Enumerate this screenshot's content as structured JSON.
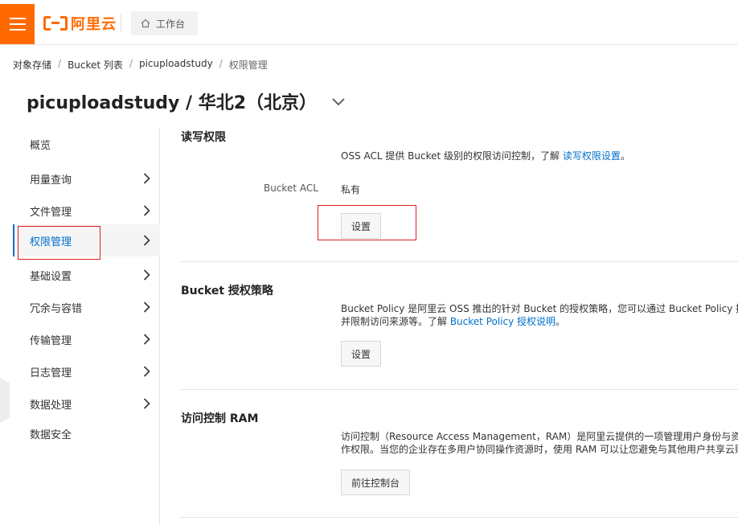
{
  "header": {
    "logo_text": "阿里云",
    "workbench_label": "工作台"
  },
  "breadcrumb": [
    "对象存储",
    "Bucket 列表",
    "picuploadstudy",
    "权限管理"
  ],
  "page_title": "picuploadstudy / 华北2（北京）",
  "sidebar": {
    "items": [
      {
        "label": "概览"
      },
      {
        "label": "用量查询"
      },
      {
        "label": "文件管理"
      },
      {
        "label": "权限管理"
      },
      {
        "label": "基础设置"
      },
      {
        "label": "冗余与容错"
      },
      {
        "label": "传输管理"
      },
      {
        "label": "日志管理"
      },
      {
        "label": "数据处理"
      },
      {
        "label": "数据安全"
      }
    ],
    "active": "权限管理"
  },
  "sections": {
    "acl": {
      "title": "读写权限",
      "desc_prefix": "OSS ACL 提供 Bucket 级别的权限访问控制，了解 ",
      "desc_link": "读写权限设置",
      "desc_suffix": "。",
      "field_label": "Bucket ACL",
      "field_value": "私有",
      "button": "设置"
    },
    "policy": {
      "title": "Bucket 授权策略",
      "desc_line1": "Bucket Policy 是阿里云 OSS 推出的针对 Bucket 的授权策略，您可以通过 Bucket Policy 授权",
      "desc_line2_prefix": "并限制访问来源等。了解 ",
      "desc_link": "Bucket Policy 授权说明",
      "desc_suffix": "。",
      "button": "设置"
    },
    "ram": {
      "title": "访问控制 RAM",
      "desc_line1": "访问控制（Resource Access Management，RAM）是阿里云提供的一项管理用户身份与资源",
      "desc_line2": "作权限。当您的企业存在多用户协同操作资源时，使用 RAM 可以让您避免与其他用户共享云账",
      "button": "前往控制台"
    }
  },
  "colors": {
    "brand": "#ff6a00",
    "link": "#0070cc",
    "highlight_box": "#e02020"
  }
}
